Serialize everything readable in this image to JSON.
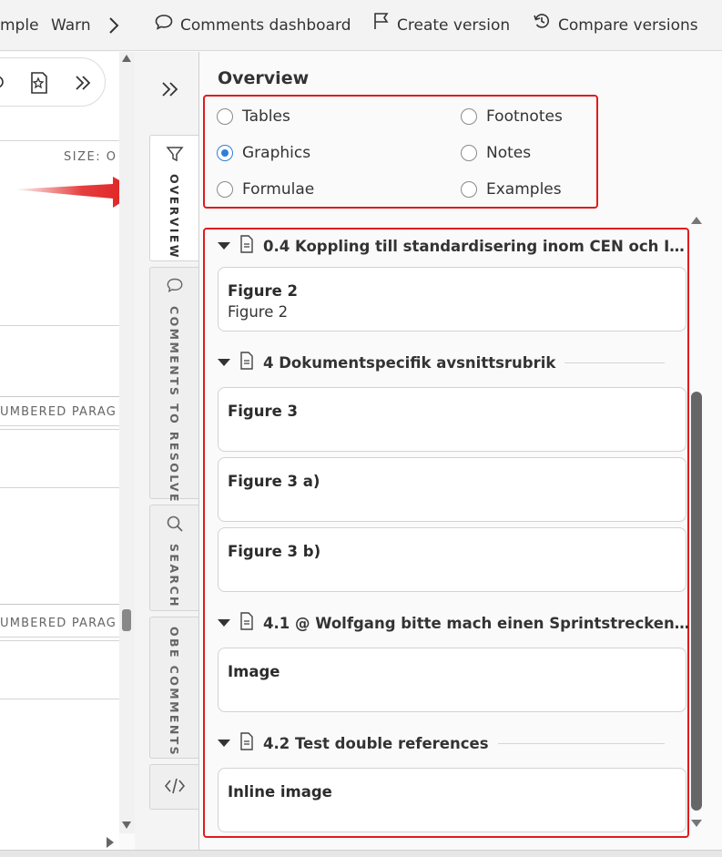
{
  "toolbar": {
    "item_sample": "mple",
    "item_warn": "Warn",
    "comments_dashboard": "Comments dashboard",
    "create_version": "Create version",
    "compare_versions": "Compare versions"
  },
  "document": {
    "size_label": "SIZE: O",
    "para_label_1": "UMBERED PARAG",
    "para_label_2": "UMBERED PARAG"
  },
  "tabs": {
    "overview": "OVERVIEW",
    "comments_to_resolve": "COMMENTS TO RESOLVE",
    "search": "SEARCH",
    "obe_comments": "OBE COMMENTS"
  },
  "panel": {
    "title": "Overview",
    "filters": [
      {
        "label": "Tables",
        "checked": false
      },
      {
        "label": "Footnotes",
        "checked": false
      },
      {
        "label": "Graphics",
        "checked": true
      },
      {
        "label": "Notes",
        "checked": false
      },
      {
        "label": "Formulae",
        "checked": false
      },
      {
        "label": "Examples",
        "checked": false
      }
    ],
    "sections": [
      {
        "title": "0.4 Koppling till standardisering inom CEN och I…",
        "items": [
          {
            "title": "Figure 2",
            "subtitle": "Figure 2"
          }
        ]
      },
      {
        "title": "4 Dokumentspecifik avsnittsrubrik",
        "items": [
          {
            "title": "Figure 3",
            "subtitle": ""
          },
          {
            "title": "Figure 3 a)",
            "subtitle": ""
          },
          {
            "title": "Figure 3 b)",
            "subtitle": ""
          }
        ]
      },
      {
        "title": "4.1 @ Wolfgang bitte mach einen Sprintstrecken…",
        "items": [
          {
            "title": "Image",
            "subtitle": ""
          }
        ]
      },
      {
        "title": "4.2 Test double references",
        "items": [
          {
            "title": "Inline image",
            "subtitle": ""
          }
        ]
      }
    ]
  },
  "colors": {
    "accent": "#2f7fd8",
    "highlight_red": "#e01c1c"
  }
}
